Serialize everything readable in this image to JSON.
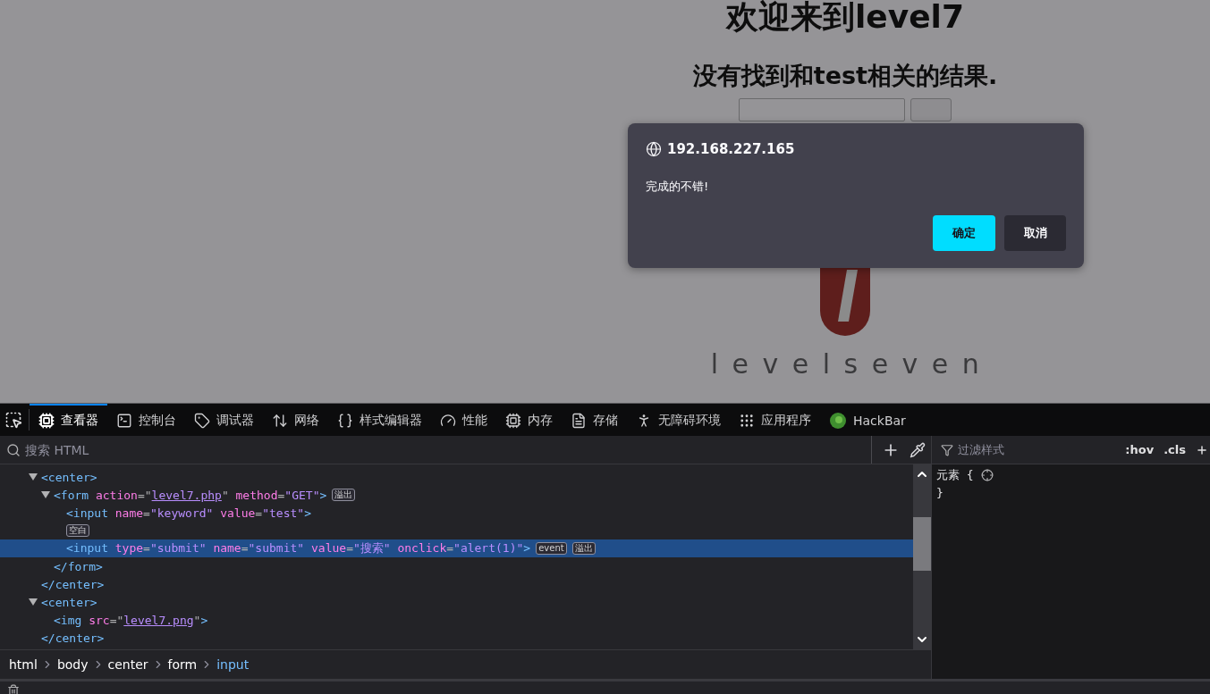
{
  "page": {
    "title": "欢迎来到level7",
    "result": "没有找到和test相关的结果.",
    "logo_text": "levelseven"
  },
  "dialog": {
    "origin": "192.168.227.165",
    "message": "完成的不错!",
    "buttons": [
      {
        "label": "确定",
        "kind": "primary"
      },
      {
        "label": "取消",
        "kind": "secondary"
      }
    ]
  },
  "devtools": {
    "tabs": [
      {
        "label": "查看器",
        "selected": true
      },
      {
        "label": "控制台",
        "selected": false
      },
      {
        "label": "调试器",
        "selected": false
      },
      {
        "label": "网络",
        "selected": false
      },
      {
        "label": "样式编辑器",
        "selected": false
      },
      {
        "label": "性能",
        "selected": false
      },
      {
        "label": "内存",
        "selected": false
      },
      {
        "label": "存储",
        "selected": false
      },
      {
        "label": "无障碍环境",
        "selected": false
      },
      {
        "label": "应用程序",
        "selected": false
      },
      {
        "label": "HackBar",
        "selected": false
      }
    ],
    "search": {
      "placeholder": "搜索 HTML"
    },
    "markup": [
      {
        "expanded": true,
        "selected": false,
        "tokens": [
          {
            "kind": "tag",
            "text": "<center>"
          }
        ],
        "close": "</center>",
        "children": [
          {
            "expanded": true,
            "selected": false,
            "tokens": [
              {
                "kind": "tag",
                "text": "<form "
              },
              {
                "kind": "attr",
                "text": "action"
              },
              {
                "kind": "punct",
                "text": "=\""
              },
              {
                "kind": "link",
                "text": "level7.php"
              },
              {
                "kind": "punct",
                "text": "\" "
              },
              {
                "kind": "attr",
                "text": "method"
              },
              {
                "kind": "punct",
                "text": "="
              },
              {
                "kind": "value",
                "text": "\"GET\""
              },
              {
                "kind": "tag",
                "text": ">"
              }
            ],
            "badges": [
              "溢出"
            ],
            "close": "</form>",
            "children": [
              {
                "selected": false,
                "tokens": [
                  {
                    "kind": "tag",
                    "text": "<input "
                  },
                  {
                    "kind": "attr",
                    "text": "name"
                  },
                  {
                    "kind": "punct",
                    "text": "="
                  },
                  {
                    "kind": "value",
                    "text": "\"keyword\" "
                  },
                  {
                    "kind": "attr",
                    "text": "value"
                  },
                  {
                    "kind": "punct",
                    "text": "="
                  },
                  {
                    "kind": "value",
                    "text": "\"test\""
                  },
                  {
                    "kind": "tag",
                    "text": ">"
                  }
                ]
              },
              {
                "selected": false,
                "badges": [
                  "空白"
                ]
              },
              {
                "selected": true,
                "tokens": [
                  {
                    "kind": "tag",
                    "text": "<input "
                  },
                  {
                    "kind": "attr",
                    "text": "type"
                  },
                  {
                    "kind": "punct",
                    "text": "="
                  },
                  {
                    "kind": "value",
                    "text": "\"submit\" "
                  },
                  {
                    "kind": "attr",
                    "text": "name"
                  },
                  {
                    "kind": "punct",
                    "text": "="
                  },
                  {
                    "kind": "value",
                    "text": "\"submit\" "
                  },
                  {
                    "kind": "attr",
                    "text": "value"
                  },
                  {
                    "kind": "punct",
                    "text": "="
                  },
                  {
                    "kind": "value",
                    "text": "\"搜索\" "
                  },
                  {
                    "kind": "attr",
                    "text": "onclick"
                  },
                  {
                    "kind": "punct",
                    "text": "="
                  },
                  {
                    "kind": "value",
                    "text": "\"alert(1)\""
                  },
                  {
                    "kind": "tag",
                    "text": ">"
                  }
                ],
                "badges": [
                  "event",
                  "溢出"
                ]
              }
            ]
          }
        ]
      },
      {
        "expanded": true,
        "selected": false,
        "tokens": [
          {
            "kind": "tag",
            "text": "<center>"
          }
        ],
        "close": "</center>",
        "children": [
          {
            "selected": false,
            "tokens": [
              {
                "kind": "tag",
                "text": "<img "
              },
              {
                "kind": "attr",
                "text": "src"
              },
              {
                "kind": "punct",
                "text": "=\""
              },
              {
                "kind": "link",
                "text": "level7.png"
              },
              {
                "kind": "punct",
                "text": "\""
              },
              {
                "kind": "tag",
                "text": ">"
              }
            ]
          }
        ]
      }
    ],
    "breadcrumbs": [
      {
        "label": "html",
        "selected": false
      },
      {
        "label": "body",
        "selected": false
      },
      {
        "label": "center",
        "selected": false
      },
      {
        "label": "form",
        "selected": false
      },
      {
        "label": "input",
        "selected": true
      }
    ],
    "rules": {
      "filter_placeholder": "过滤样式",
      "hov": ":hov",
      "cls": ".cls",
      "selector": "元素 {",
      "close": "}"
    }
  }
}
